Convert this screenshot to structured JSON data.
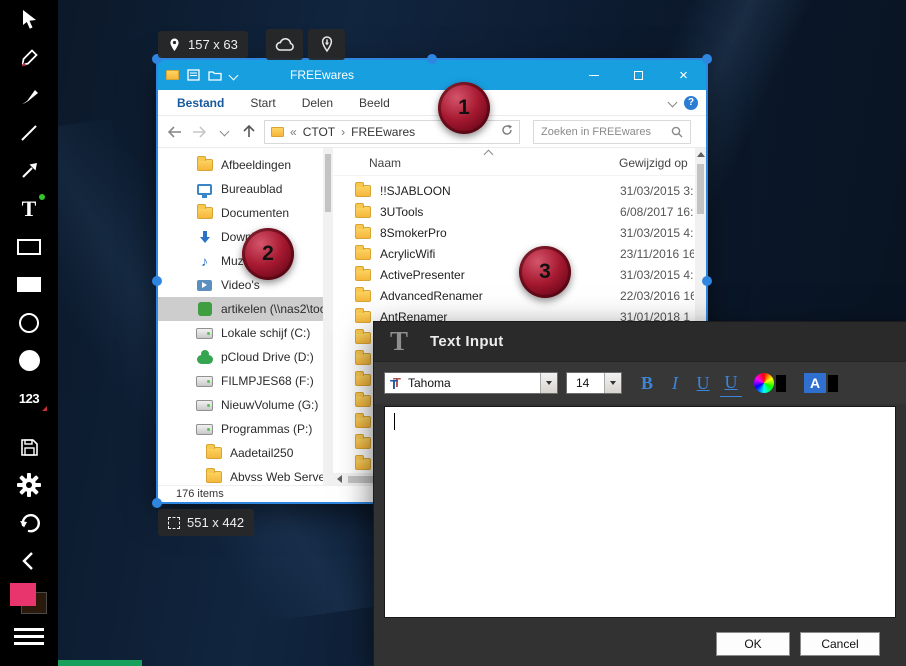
{
  "colors": {
    "titlebar_blue": "#189fe0",
    "selection_blue": "#2f86e1",
    "badge_red": "#a61930",
    "swatch_pink": "#e8356d",
    "format_blue": "#3d85d8"
  },
  "capture": {
    "top_size": "157 x 63",
    "bottom_size": "551 x 442"
  },
  "annotations": {
    "badges": [
      "1",
      "2",
      "3"
    ]
  },
  "sidebar": {
    "text_tool_glyph": "T",
    "numbers_tool_glyph": "123"
  },
  "icons": {
    "music": "♪"
  },
  "explorer": {
    "title": "FREEwares",
    "menu": {
      "tabs": [
        "Bestand",
        "Start",
        "Delen",
        "Beeld"
      ],
      "help_glyph": "?"
    },
    "window_controls": {
      "close_glyph": "×"
    },
    "address": {
      "collapsed_glyph": "«",
      "crumbs": [
        "CTOT",
        "FREEwares"
      ],
      "separator": "›"
    },
    "search_placeholder": "Zoeken in FREEwares",
    "nav": [
      {
        "label": "Afbeeldingen"
      },
      {
        "label": "Bureaublad"
      },
      {
        "label": "Documenten"
      },
      {
        "label": "Downloads"
      },
      {
        "label": "Muziek"
      },
      {
        "label": "Video's"
      },
      {
        "label": "artikelen (\\\\nas2\\too"
      },
      {
        "label": "Lokale schijf (C:)"
      },
      {
        "label": "pCloud Drive (D:)"
      },
      {
        "label": "FILMPJES68 (F:)"
      },
      {
        "label": "NieuwVolume (G:)"
      },
      {
        "label": "Programmas (P:)"
      },
      {
        "label": "Aadetail250"
      },
      {
        "label": "Abvss Web Server"
      }
    ],
    "list": {
      "columns": [
        "Naam",
        "Gewijzigd op"
      ],
      "files": [
        {
          "name": "!!SJABLOON",
          "date": "31/03/2015 3:"
        },
        {
          "name": "3UTools",
          "date": "6/08/2017 16:"
        },
        {
          "name": "8SmokerPro",
          "date": "31/03/2015 4:"
        },
        {
          "name": "AcrylicWifi",
          "date": "23/11/2016 16"
        },
        {
          "name": "ActivePresenter",
          "date": "31/03/2015 4:"
        },
        {
          "name": "AdvancedRenamer",
          "date": "22/03/2016 16"
        },
        {
          "name": "AntRenamer",
          "date": "31/01/2018 1"
        }
      ]
    },
    "status": "176 items"
  },
  "dialog": {
    "icon_glyph": "T",
    "title": "Text Input",
    "truetype_glyph": "T",
    "font_name": "Tahoma",
    "font_size": "14",
    "bold_label": "B",
    "italic_label": "I",
    "underline_label": "U",
    "underline2_label": "U",
    "highlight_label": "A",
    "ok": "OK",
    "cancel": "Cancel"
  }
}
